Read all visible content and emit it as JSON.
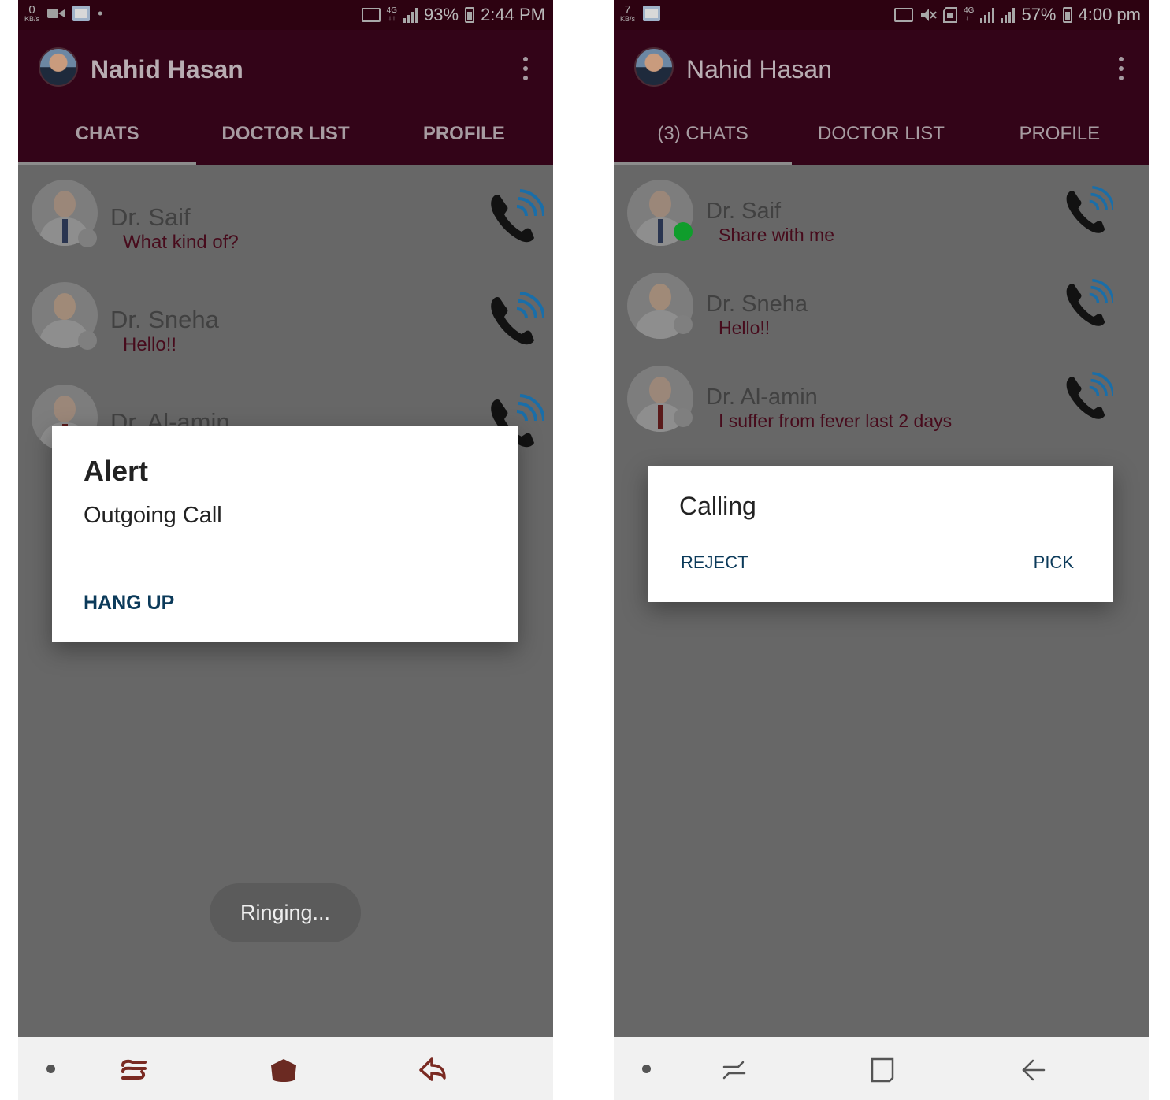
{
  "screens": [
    {
      "status": {
        "kbs": "0",
        "kbs_unit": "KB/s",
        "network": "4G",
        "battery": "93%",
        "time": "2:44 PM"
      },
      "app": {
        "user_name": "Nahid Hasan"
      },
      "tabs": [
        "CHATS",
        "DOCTOR LIST",
        "PROFILE"
      ],
      "chats": [
        {
          "name": "Dr. Saif",
          "message": "What kind of?",
          "online": false
        },
        {
          "name": "Dr. Sneha",
          "message": "Hello!!",
          "online": false
        },
        {
          "name": "Dr. Al-amin",
          "message": "",
          "online": false
        }
      ],
      "dialog": {
        "title": "Alert",
        "body": "Outgoing Call",
        "button": "HANG UP"
      },
      "toast": "Ringing..."
    },
    {
      "status": {
        "kbs": "7",
        "kbs_unit": "KB/s",
        "network": "4G",
        "battery": "57%",
        "time": "4:00 pm"
      },
      "app": {
        "user_name": "Nahid Hasan"
      },
      "tabs": [
        "(3) CHATS",
        "DOCTOR LIST",
        "PROFILE"
      ],
      "chats": [
        {
          "name": "Dr. Saif",
          "message": "Share with me",
          "online": true
        },
        {
          "name": "Dr. Sneha",
          "message": "Hello!!",
          "online": false
        },
        {
          "name": "Dr. Al-amin",
          "message": "I suffer from fever last 2 days",
          "online": false
        }
      ],
      "dialog": {
        "title": "Calling",
        "reject": "REJECT",
        "pick": "PICK"
      }
    }
  ],
  "colors": {
    "appbar": "#330418",
    "statusbar": "#2d0211",
    "scrim_bg": "#676767",
    "message_text": "#470b1c",
    "dialog_button": "#0b3a5a",
    "online_dot": "#0f9d2c",
    "call_icon_waves": "#1a6ea8"
  },
  "icons": [
    "video-icon",
    "gallery-icon",
    "cast-icon",
    "mute-icon",
    "sd-icon",
    "signal-icon",
    "battery-icon",
    "more-vert-icon",
    "phone-call-icon",
    "recent-apps-icon",
    "home-icon",
    "back-icon"
  ]
}
